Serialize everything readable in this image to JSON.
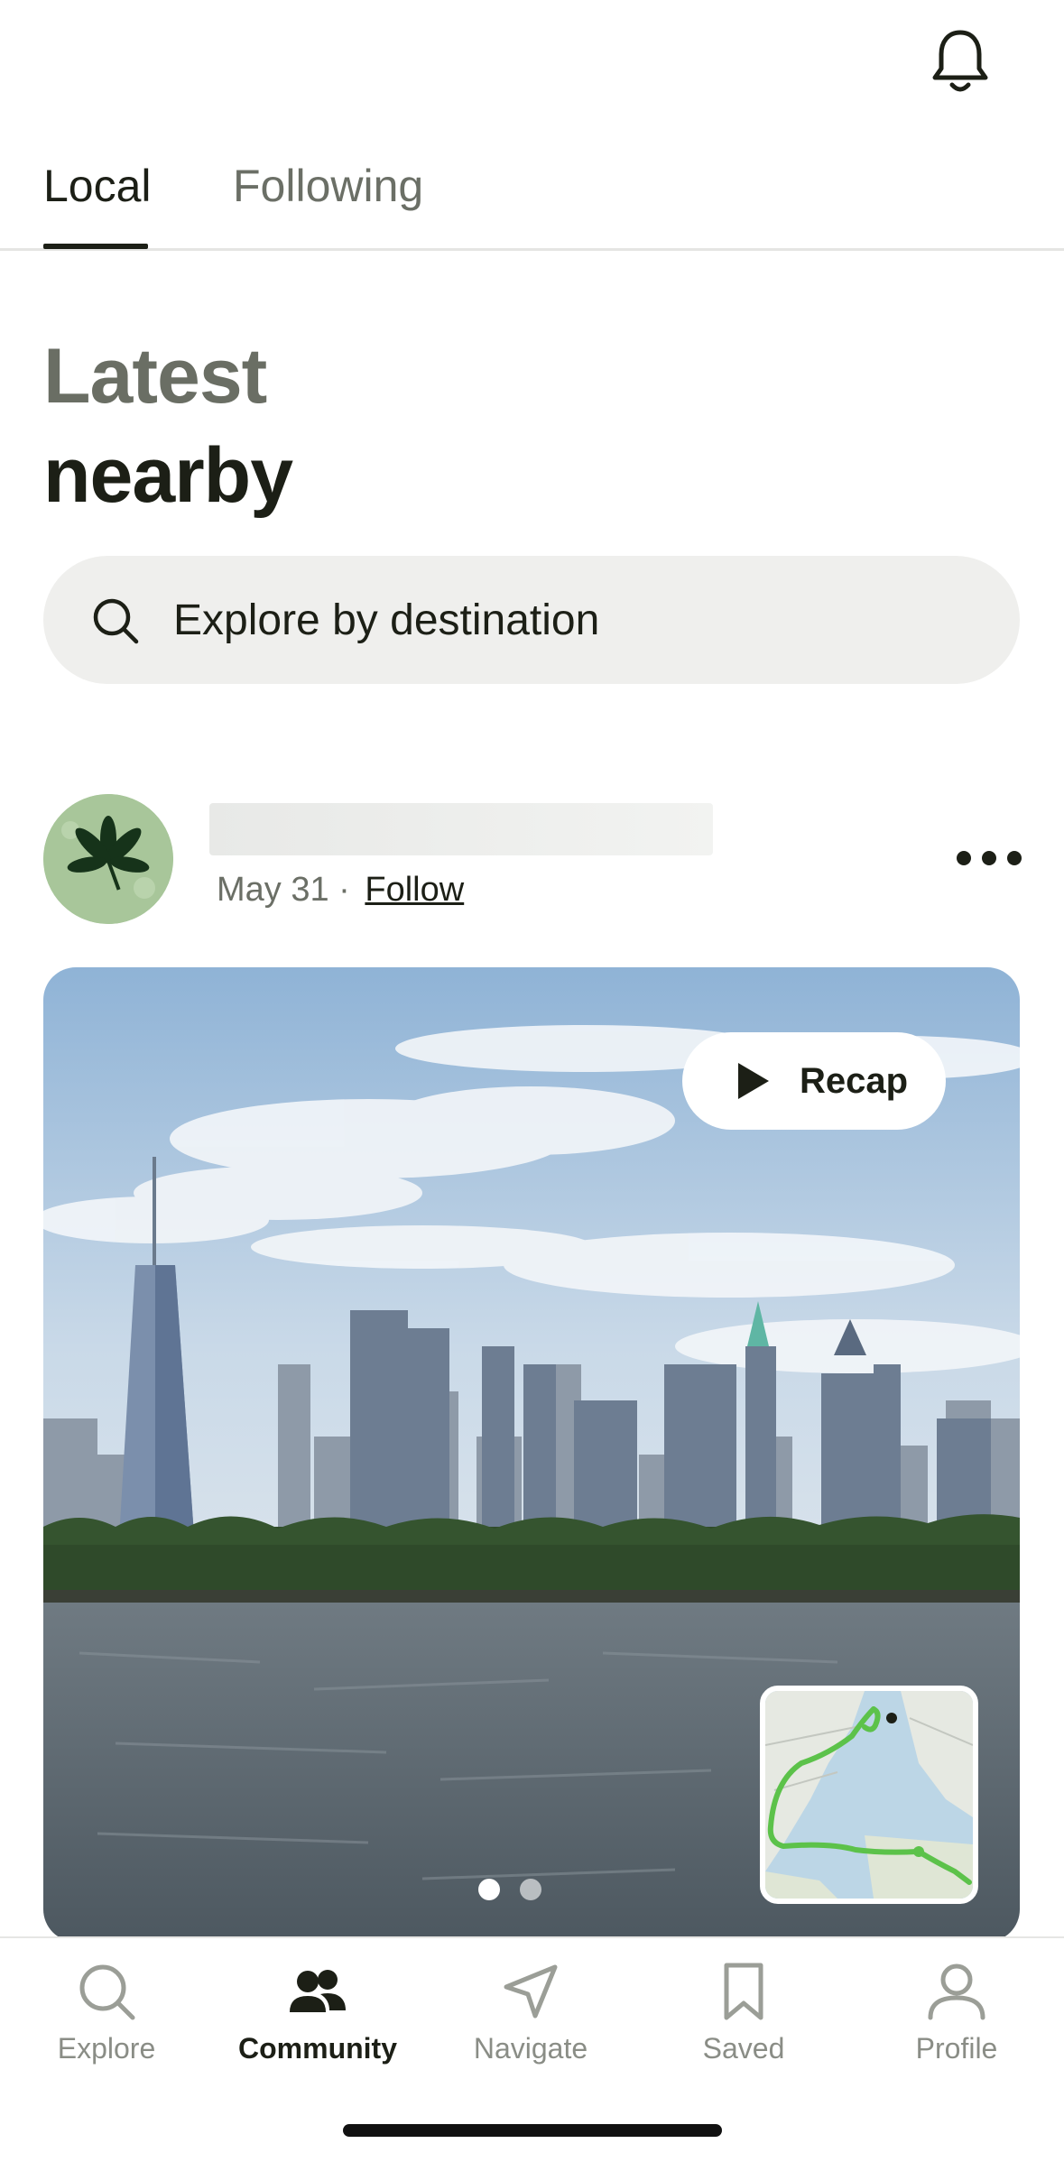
{
  "header": {
    "notifications_icon": "bell-icon"
  },
  "tabs": [
    {
      "label": "Local",
      "active": true
    },
    {
      "label": "Following",
      "active": false
    }
  ],
  "heading": {
    "line1": "Latest",
    "line2": "nearby"
  },
  "search": {
    "placeholder": "Explore by destination",
    "icon": "search-icon"
  },
  "post": {
    "date": "May 31 ·",
    "follow_label": "Follow",
    "recap_label": "Recap",
    "photo_count": 2,
    "active_photo": 1
  },
  "bottom_nav": [
    {
      "label": "Explore",
      "icon": "search-icon",
      "active": false
    },
    {
      "label": "Community",
      "icon": "community-icon",
      "active": true
    },
    {
      "label": "Navigate",
      "icon": "navigate-icon",
      "active": false
    },
    {
      "label": "Saved",
      "icon": "bookmark-icon",
      "active": false
    },
    {
      "label": "Profile",
      "icon": "profile-icon",
      "active": false
    }
  ],
  "colors": {
    "primary_text": "#1c1f16",
    "muted_text": "#6b6f66",
    "search_bg": "#efefed",
    "route_green": "#5cc24a"
  }
}
